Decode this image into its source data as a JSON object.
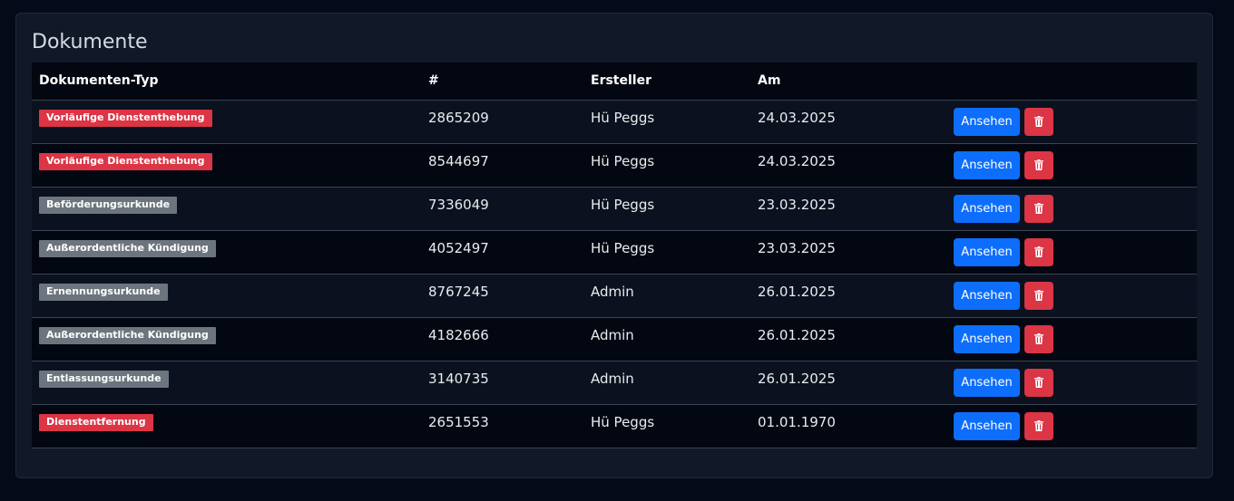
{
  "page": {
    "title": "Dokumente"
  },
  "table": {
    "headers": {
      "type": "Dokumenten-Typ",
      "number": "#",
      "creator": "Ersteller",
      "date": "Am",
      "actions": ""
    },
    "rows": [
      {
        "type": "Vorläufige Dienstenthebung",
        "type_color": "#dc3545",
        "number": "2865209",
        "creator": "Hü Peggs",
        "date": "24.03.2025"
      },
      {
        "type": "Vorläufige Dienstenthebung",
        "type_color": "#dc3545",
        "number": "8544697",
        "creator": "Hü Peggs",
        "date": "24.03.2025"
      },
      {
        "type": "Beförderungsurkunde",
        "type_color": "#6c757d",
        "number": "7336049",
        "creator": "Hü Peggs",
        "date": "23.03.2025"
      },
      {
        "type": "Außerordentliche Kündigung",
        "type_color": "#6c757d",
        "number": "4052497",
        "creator": "Hü Peggs",
        "date": "23.03.2025"
      },
      {
        "type": "Ernennungsurkunde",
        "type_color": "#6c757d",
        "number": "8767245",
        "creator": "Admin",
        "date": "26.01.2025"
      },
      {
        "type": "Außerordentliche Kündigung",
        "type_color": "#6c757d",
        "number": "4182666",
        "creator": "Admin",
        "date": "26.01.2025"
      },
      {
        "type": "Entlassungsurkunde",
        "type_color": "#6c757d",
        "number": "3140735",
        "creator": "Admin",
        "date": "26.01.2025"
      },
      {
        "type": "Dienstentfernung",
        "type_color": "#dc3545",
        "number": "2651553",
        "creator": "Hü Peggs",
        "date": "01.01.1970"
      }
    ]
  },
  "actions": {
    "view_label": "Ansehen",
    "delete_icon": "trash-icon"
  },
  "colors": {
    "primary": "#0d6efd",
    "danger": "#dc3545",
    "secondary": "#6c757d"
  }
}
